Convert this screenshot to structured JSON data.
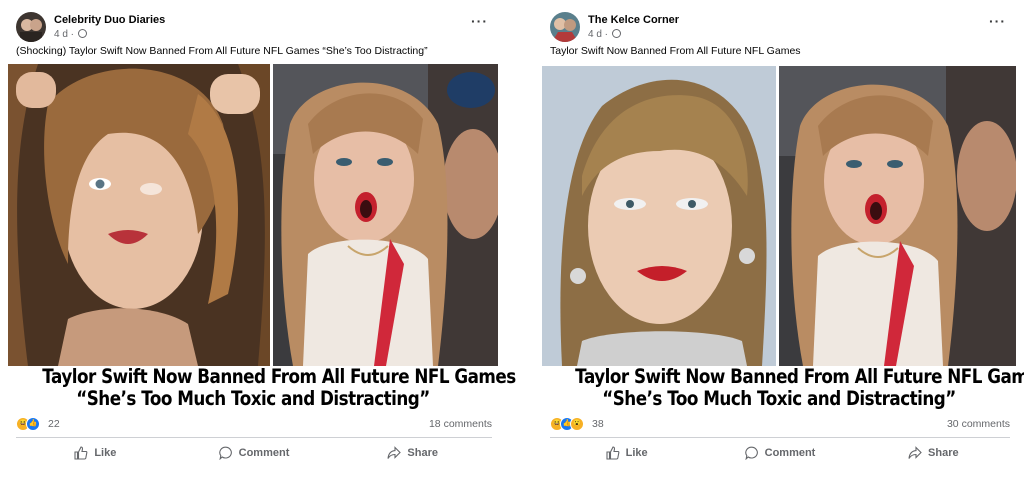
{
  "posts": [
    {
      "page_name": "Celebrity Duo Diaries",
      "time": "4 d ·",
      "caption": "(Shocking) Taylor Swift Now Banned From All Future NFL Games “She’s Too Distracting”",
      "banner_line1": "Taylor Swift Now Banned From All Future NFL Games",
      "banner_line2": "“She’s Too Much Toxic and Distracting”",
      "reaction_count": "22",
      "comment_count": "18 comments",
      "reactions": [
        "haha-icon",
        "like-icon"
      ],
      "actions": {
        "like": "Like",
        "comment": "Comment",
        "share": "Share"
      }
    },
    {
      "page_name": "The Kelce Corner",
      "time": "4 d ·",
      "caption": "Taylor Swift Now Banned From All Future NFL Games",
      "banner_line1": "Taylor Swift Now Banned From All Future NFL Games",
      "banner_line2": "“She’s Too Much Toxic and Distracting”",
      "reaction_count": "38",
      "comment_count": "30 comments",
      "reactions": [
        "haha-icon",
        "like-icon",
        "wow-icon"
      ],
      "actions": {
        "like": "Like",
        "comment": "Comment",
        "share": "Share"
      }
    }
  ],
  "colors": {
    "text_primary": "#050505",
    "text_secondary": "#65676b",
    "like_blue": "#1877f2",
    "reaction_yellow": "#f7b125",
    "divider": "#ced0d4"
  }
}
